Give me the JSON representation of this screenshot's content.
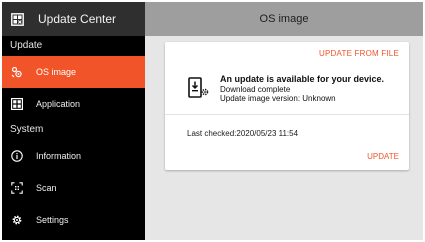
{
  "app": {
    "title": "Update Center"
  },
  "sidebar": {
    "sections": [
      {
        "label": "Update"
      },
      {
        "label": "System"
      }
    ],
    "items": [
      {
        "label": "OS image",
        "icon": "os-image-icon",
        "active": true
      },
      {
        "label": "Application",
        "icon": "application-icon"
      },
      {
        "label": "Information",
        "icon": "info-icon"
      },
      {
        "label": "Scan",
        "icon": "scan-icon"
      },
      {
        "label": "Settings",
        "icon": "gear-icon"
      }
    ]
  },
  "main": {
    "title": "OS image",
    "card": {
      "update_from_file": "UPDATE FROM FILE",
      "headline": "An update is available for your device.",
      "status": "Download complete",
      "version": "Update image version: Unknown",
      "last_checked": "Last checked:2020/05/23 11:54",
      "update_button": "UPDATE"
    }
  },
  "colors": {
    "accent": "#f05428",
    "sidebar_bg": "#000000",
    "header_bg": "#2f2f2f",
    "main_header_bg": "#9e9e9e",
    "main_bg": "#e6e6e6"
  }
}
